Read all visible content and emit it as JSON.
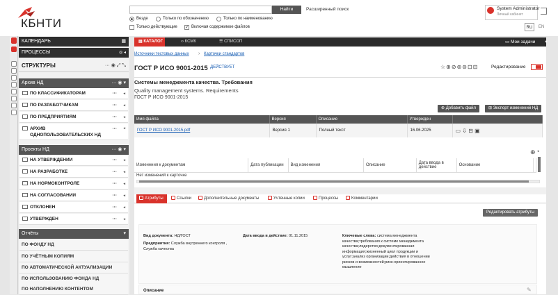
{
  "brand": {
    "logo_text": "КБНТИ",
    "accent": "#d9322b"
  },
  "search": {
    "placeholder": "",
    "find_label": "Найти",
    "advanced_label": "Расширенный поиск",
    "options": [
      {
        "label": "Везде",
        "selected": true
      },
      {
        "label": "Только по обозначению",
        "selected": false
      },
      {
        "label": "Только по наименованию",
        "selected": false
      }
    ],
    "checks": [
      {
        "label": "Только действующие",
        "checked": false
      },
      {
        "label": "Включая содержимое файлов",
        "checked": true
      }
    ]
  },
  "user": {
    "name": "System Administrator",
    "sub": "Личный кабинет"
  },
  "lang": [
    "RU",
    "EN"
  ],
  "sidebar": {
    "calendar": "КАЛЕНДАРЬ",
    "processes": "ПРОЦЕССЫ",
    "structures": "СТРУКТУРЫ",
    "archive_header": "Архив НД",
    "archive_items": [
      "ПО КЛАССИФИКАТОРАМ",
      "ПО РАЗРАБОТЧИКАМ",
      "ПО ПРЕДПРИЯТИЯМ",
      "АРХИВ ОДНОПОЛЬЗОВАТЕЛЬСКИХ НД"
    ],
    "projects_header": "Проекты НД",
    "project_items": [
      "НА УТВЕРЖДЕНИИ",
      "НА РАЗРАБОТКЕ",
      "НА НОРМОКОНТРОЛЕ",
      "НА СОГЛАСОВАНИИ",
      "ОТКЛОНЕН",
      "УТВЕРЖДЕН"
    ],
    "reports_header": "Отчёты",
    "report_items": [
      "ПО ФОНДУ НД",
      "ПО УЧЁТНЫМ КОПИЯМ",
      "ПО АВТОМАТИЧЕСКОЙ АКТУАЛИЗАЦИИ",
      "ПО ИСПОЛЬЗОВАНИЮ ФОНДА НД",
      "ПО НАПОЛНЕНИЮ КОНТЕНТОМ"
    ]
  },
  "tabs": [
    "КАТАЛОГ",
    "КСМК",
    "СПИСОП"
  ],
  "tasks_label": "Мои задачи",
  "breadcrumb": [
    "Источники тестовых данных",
    "Карточки стандартов"
  ],
  "doc": {
    "title": "ГОСТ Р ИСО 9001-2015",
    "status": "ДЕЙСТВУЕТ",
    "edit_label": "Редактирование",
    "name_ru": "Системы менеджмента качества. Требования",
    "name_en": "Quality management systems. Requirements",
    "code": "ГОСТ Р ИСО 9001-2015"
  },
  "buttons": {
    "add_file": "Добавить файл",
    "export_changes": "Экспорт изменений НД",
    "edit_attrs": "Редактировать атрибуты"
  },
  "files": {
    "headers": [
      "Имя файла",
      "Версия",
      "Описание",
      "Утвержден"
    ],
    "rows": [
      {
        "name": "ГОСТ Р ИСО 9001-2015.pdf",
        "version": "Версия 1",
        "desc": "Полный текст",
        "date": "16.06.2025"
      }
    ]
  },
  "changes": {
    "headers": [
      "Изменения к документам",
      "Дата публикации",
      "Вид изменения",
      "Описание",
      "Дата ввода в действие",
      "Основание"
    ],
    "empty": "Нет изменений к карточке"
  },
  "detail_tabs": [
    "Атрибуты",
    "Ссылки",
    "Дополнительные документы",
    "Учтенные копии",
    "Процессы",
    "Комментарии"
  ],
  "attrs": {
    "doc_type_label": "Вид документа:",
    "doc_type": "НД/ГОСТ",
    "enterprise_label": "Предприятия:",
    "enterprise": "Служба внутреннего контроля , Служба качества",
    "start_label": "Дата ввода в действие:",
    "start": "01.11.2015",
    "keywords_label": "Ключевые слова:",
    "keywords": "система менеджмента качества;требования к системе менеджмента качества;лидерство;документированная информация;жизненный цикл продукции и услуг;анализ организации;действия в отношении рисков и возможностей;риск-ориентированное мышление"
  },
  "description_label": "Описание"
}
